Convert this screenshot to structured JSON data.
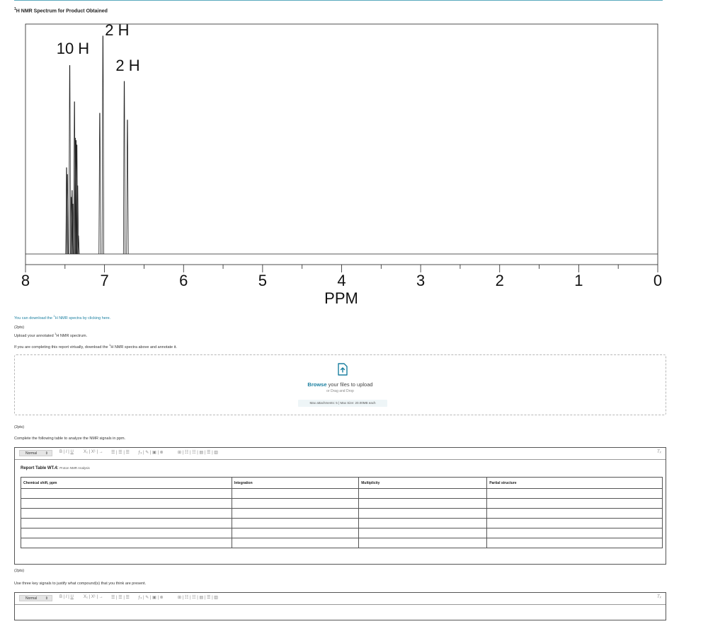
{
  "spectrum": {
    "title_sup": "1",
    "title_rest": "H NMR Spectrum for Product Obtained",
    "xlabel": "PPM",
    "ticks": [
      "8",
      "7",
      "6",
      "5",
      "4",
      "3",
      "2",
      "1",
      "0"
    ],
    "annotations": [
      "10 H",
      "2 H",
      "2 H"
    ]
  },
  "chart_data": {
    "type": "line",
    "title": "1H NMR Spectrum for Product Obtained",
    "xlabel": "PPM",
    "ylabel": "",
    "xlim": [
      8,
      0
    ],
    "x_reversed": true,
    "grid": false,
    "peaks": [
      {
        "ppm": 7.48,
        "intensity": 0.38
      },
      {
        "ppm": 7.47,
        "intensity": 0.35
      },
      {
        "ppm": 7.44,
        "intensity": 0.83
      },
      {
        "ppm": 7.42,
        "intensity": 0.25
      },
      {
        "ppm": 7.41,
        "intensity": 0.28
      },
      {
        "ppm": 7.4,
        "intensity": 0.22
      },
      {
        "ppm": 7.38,
        "intensity": 0.67
      },
      {
        "ppm": 7.37,
        "intensity": 0.51
      },
      {
        "ppm": 7.36,
        "intensity": 0.5
      },
      {
        "ppm": 7.35,
        "intensity": 0.48
      },
      {
        "ppm": 7.34,
        "intensity": 0.3
      },
      {
        "ppm": 7.33,
        "intensity": 0.08
      },
      {
        "ppm": 7.06,
        "intensity": 0.62
      },
      {
        "ppm": 7.02,
        "intensity": 0.96
      },
      {
        "ppm": 6.75,
        "intensity": 0.76
      },
      {
        "ppm": 6.71,
        "intensity": 0.59
      }
    ],
    "annotations": [
      {
        "text": "10 H",
        "ppm": 7.4
      },
      {
        "text": "2 H",
        "ppm": 7.02
      },
      {
        "text": "2 H",
        "ppm": 6.75
      }
    ]
  },
  "download": {
    "before": "You can download the ",
    "sup": "1",
    "after": "H NMR spectra by clicking here."
  },
  "q1": {
    "points": "(2pts)",
    "prompt_before": "Upload your annotated ",
    "prompt_sup": "1",
    "prompt_after": "H NMR spectrum.",
    "note_before": "If you are completing this report virtually, download the ",
    "note_sup": "1",
    "note_after": "H NMR spectra above and annotate it."
  },
  "upload": {
    "icon": "upload-file-icon",
    "browse": "Browse",
    "rest": " your files to upload",
    "alt": "or Drag and Drop",
    "limits": "Max attachments: 5 | Max Size: 20.00MB each"
  },
  "q2": {
    "points": "(2pts)",
    "prompt": "Complete the following table to analyze the NMR signals in ppm."
  },
  "editor1": {
    "format": "Normal",
    "report_label": "Report Table WT.4:",
    "report_caption": "Proton NMR Analysis",
    "columns": [
      "Chemical shift, ppm",
      "Integration",
      "Multiplicity",
      "Partial structure"
    ],
    "rows": 6
  },
  "q3": {
    "points": "(2pts)",
    "prompt": "Use three key signals to justify what compound(s) that you think are present."
  },
  "editor2": {
    "format": "Normal"
  },
  "colors": {
    "accent": "#1a7fa0",
    "rule": "#5aa9bd",
    "spectrum_line": "#222222"
  }
}
